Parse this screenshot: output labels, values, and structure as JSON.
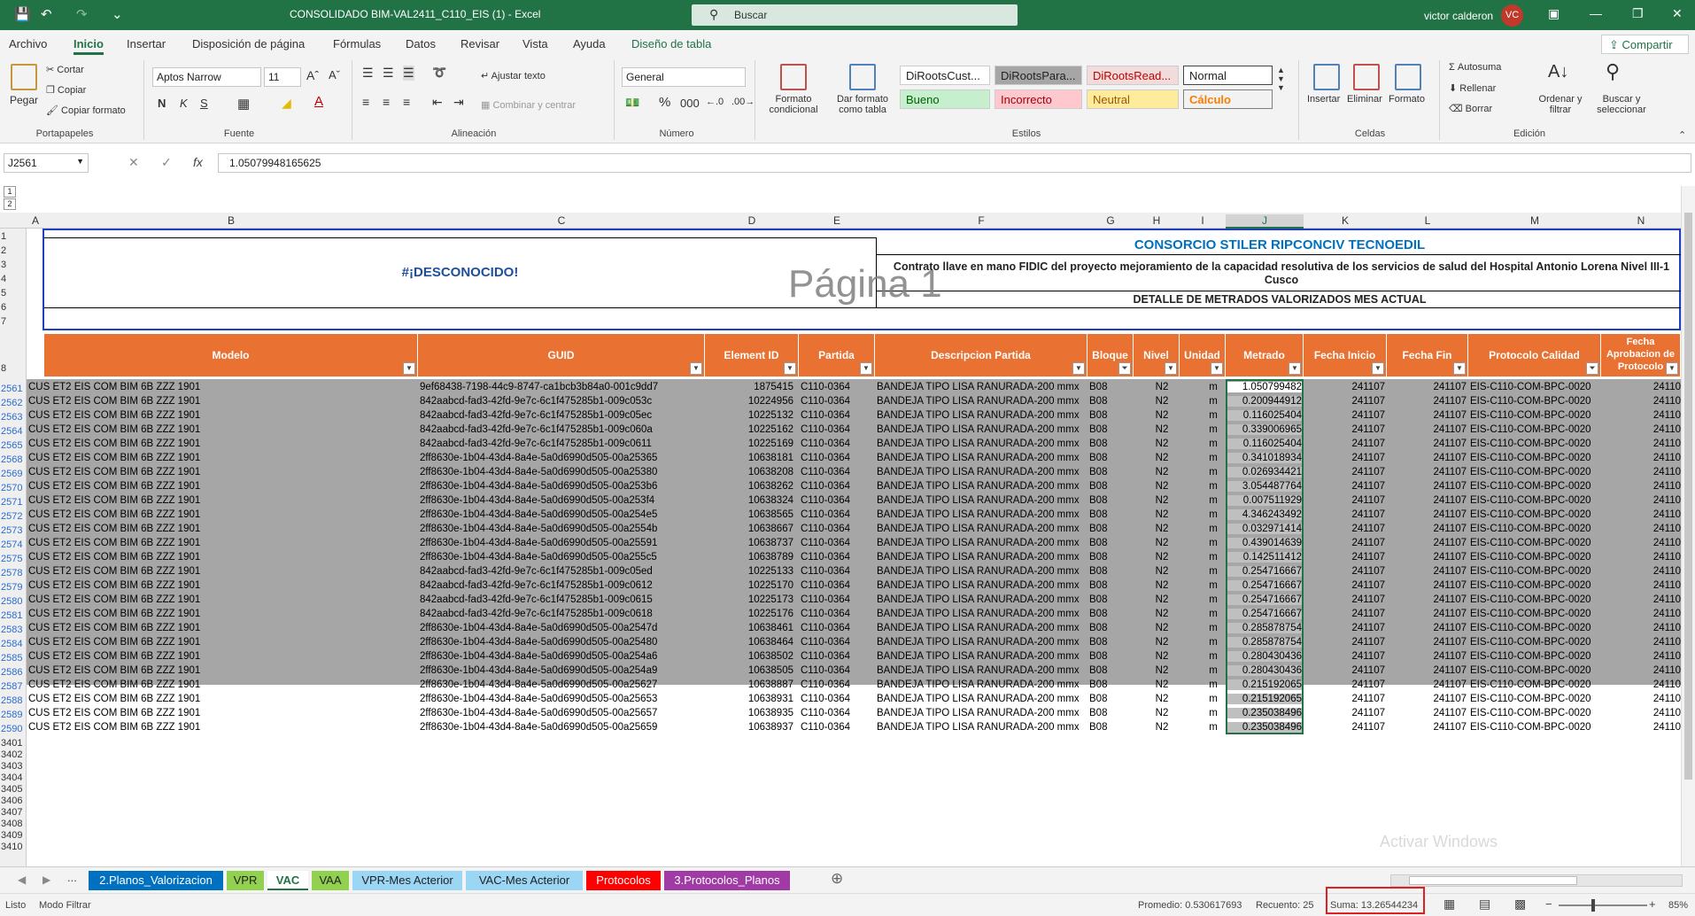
{
  "titlebar": {
    "title": "CONSOLIDADO BIM-VAL2411_C110_EIS (1)  -  Excel",
    "search_placeholder": "Buscar",
    "user": "victor calderon",
    "avatar": "VC"
  },
  "menu": {
    "items": [
      "Archivo",
      "Inicio",
      "Insertar",
      "Disposición de página",
      "Fórmulas",
      "Datos",
      "Revisar",
      "Vista",
      "Ayuda",
      "Diseño de tabla"
    ],
    "share": "Compartir"
  },
  "ribbon": {
    "pegar": "Pegar",
    "cortar": "Cortar",
    "copiar": "Copiar",
    "copiar_formato": "Copiar formato",
    "portapapeles": "Portapapeles",
    "font": "Aptos Narrow",
    "size": "11",
    "fuente": "Fuente",
    "bold": "N",
    "italic": "K",
    "underline": "S",
    "ajustar": "Ajustar texto",
    "combinar": "Combinar y centrar",
    "alineacion": "Alineación",
    "numfmt": "General",
    "numero": "Número",
    "pct": "%",
    "formato_cond": "Formato condicional",
    "dar_formato": "Dar formato como tabla",
    "styles": [
      "DiRootsCust...",
      "DiRootsPara...",
      "DiRootsRead...",
      "Normal",
      "Bueno",
      "Incorrecto",
      "Neutral",
      "Cálculo"
    ],
    "estilos": "Estilos",
    "insertar": "Insertar",
    "eliminar": "Eliminar",
    "formato": "Formato",
    "celdas": "Celdas",
    "autosuma": "Autosuma",
    "rellenar": "Rellenar",
    "borrar": "Borrar",
    "ordenar": "Ordenar y filtrar",
    "buscar": "Buscar y seleccionar",
    "edicion": "Edición"
  },
  "formula": {
    "namebox": "J2561",
    "value": "1.05079948165625"
  },
  "columns": [
    "A",
    "B",
    "C",
    "D",
    "E",
    "F",
    "G",
    "H",
    "I",
    "J",
    "K",
    "L",
    "M",
    "N"
  ],
  "sheet_header": {
    "unknown": "#¡DESCONOCIDO!",
    "consorcio": "CONSORCIO STILER RIPCONCIV TECNOEDIL",
    "contrato": "Contrato llave en mano FIDIC del proyecto mejoramiento de la capacidad resolutiva de los servicios de salud del Hospital Antonio Lorena Nivel III-1 Cusco",
    "detalle": "DETALLE DE METRADOS VALORIZADOS MES ACTUAL",
    "pagina": "Página 1"
  },
  "table_headers": [
    "Modelo",
    "GUID",
    "Element ID",
    "Partida",
    "Descripcion Partida",
    "Bloque",
    "Nivel",
    "Unidad",
    "Metrado",
    "Fecha Inicio",
    "Fecha Fin",
    "Protocolo Calidad",
    "Fecha Aprobacion de Protocolo"
  ],
  "header_rows": [
    "1",
    "2",
    "3",
    "4",
    "5",
    "6",
    "7",
    "8"
  ],
  "rows": [
    {
      "n": "2561",
      "guid": "9ef68438-7198-44c9-8747-ca1bcb3b84a0-001c9dd7",
      "eid": "1875415",
      "met": "1.050799482"
    },
    {
      "n": "2562",
      "guid": "842aabcd-fad3-42fd-9e7c-6c1f475285b1-009c053c",
      "eid": "10224956",
      "met": "0.200944912"
    },
    {
      "n": "2563",
      "guid": "842aabcd-fad3-42fd-9e7c-6c1f475285b1-009c05ec",
      "eid": "10225132",
      "met": "0.116025404"
    },
    {
      "n": "2564",
      "guid": "842aabcd-fad3-42fd-9e7c-6c1f475285b1-009c060a",
      "eid": "10225162",
      "met": "0.339006965"
    },
    {
      "n": "2565",
      "guid": "842aabcd-fad3-42fd-9e7c-6c1f475285b1-009c0611",
      "eid": "10225169",
      "met": "0.116025404"
    },
    {
      "n": "2568",
      "guid": "2ff8630e-1b04-43d4-8a4e-5a0d6990d505-00a25365",
      "eid": "10638181",
      "met": "0.341018934"
    },
    {
      "n": "2569",
      "guid": "2ff8630e-1b04-43d4-8a4e-5a0d6990d505-00a25380",
      "eid": "10638208",
      "met": "0.026934421"
    },
    {
      "n": "2570",
      "guid": "2ff8630e-1b04-43d4-8a4e-5a0d6990d505-00a253b6",
      "eid": "10638262",
      "met": "3.054487764"
    },
    {
      "n": "2571",
      "guid": "2ff8630e-1b04-43d4-8a4e-5a0d6990d505-00a253f4",
      "eid": "10638324",
      "met": "0.007511929"
    },
    {
      "n": "2572",
      "guid": "2ff8630e-1b04-43d4-8a4e-5a0d6990d505-00a254e5",
      "eid": "10638565",
      "met": "4.346243492"
    },
    {
      "n": "2573",
      "guid": "2ff8630e-1b04-43d4-8a4e-5a0d6990d505-00a2554b",
      "eid": "10638667",
      "met": "0.032971414"
    },
    {
      "n": "2574",
      "guid": "2ff8630e-1b04-43d4-8a4e-5a0d6990d505-00a25591",
      "eid": "10638737",
      "met": "0.439014639"
    },
    {
      "n": "2575",
      "guid": "2ff8630e-1b04-43d4-8a4e-5a0d6990d505-00a255c5",
      "eid": "10638789",
      "met": "0.142511412"
    },
    {
      "n": "2578",
      "guid": "842aabcd-fad3-42fd-9e7c-6c1f475285b1-009c05ed",
      "eid": "10225133",
      "met": "0.254716667"
    },
    {
      "n": "2579",
      "guid": "842aabcd-fad3-42fd-9e7c-6c1f475285b1-009c0612",
      "eid": "10225170",
      "met": "0.254716667"
    },
    {
      "n": "2580",
      "guid": "842aabcd-fad3-42fd-9e7c-6c1f475285b1-009c0615",
      "eid": "10225173",
      "met": "0.254716667"
    },
    {
      "n": "2581",
      "guid": "842aabcd-fad3-42fd-9e7c-6c1f475285b1-009c0618",
      "eid": "10225176",
      "met": "0.254716667"
    },
    {
      "n": "2583",
      "guid": "2ff8630e-1b04-43d4-8a4e-5a0d6990d505-00a2547d",
      "eid": "10638461",
      "met": "0.285878754"
    },
    {
      "n": "2584",
      "guid": "2ff8630e-1b04-43d4-8a4e-5a0d6990d505-00a25480",
      "eid": "10638464",
      "met": "0.285878754"
    },
    {
      "n": "2585",
      "guid": "2ff8630e-1b04-43d4-8a4e-5a0d6990d505-00a254a6",
      "eid": "10638502",
      "met": "0.280430436"
    },
    {
      "n": "2586",
      "guid": "2ff8630e-1b04-43d4-8a4e-5a0d6990d505-00a254a9",
      "eid": "10638505",
      "met": "0.280430436"
    },
    {
      "n": "2587",
      "guid": "2ff8630e-1b04-43d4-8a4e-5a0d6990d505-00a25627",
      "eid": "10638887",
      "met": "0.215192065"
    },
    {
      "n": "2588",
      "guid": "2ff8630e-1b04-43d4-8a4e-5a0d6990d505-00a25653",
      "eid": "10638931",
      "met": "0.215192065"
    },
    {
      "n": "2589",
      "guid": "2ff8630e-1b04-43d4-8a4e-5a0d6990d505-00a25657",
      "eid": "10638935",
      "met": "0.235038496"
    },
    {
      "n": "2590",
      "guid": "2ff8630e-1b04-43d4-8a4e-5a0d6990d505-00a25659",
      "eid": "10638937",
      "met": "0.235038496"
    }
  ],
  "row_common": {
    "modelo": "CUS ET2 EIS COM BIM 6B ZZZ 1901",
    "partida": "C110-0364",
    "desc": "BANDEJA TIPO LISA RANURADA-200 mmx",
    "bloque": "B08",
    "nivel": "N2",
    "unidad": "m",
    "fi": "241107",
    "ff": "241107",
    "prot": "EIS-C110-COM-BPC-0020",
    "fap": "24110"
  },
  "empty_rows": [
    "3401",
    "3402",
    "3403",
    "3404",
    "3405",
    "3406",
    "3407",
    "3408",
    "3409",
    "3410"
  ],
  "tabs": [
    {
      "label": "...",
      "color": "#f3f3f3"
    },
    {
      "label": "2.Planos_Valorizacion",
      "color": "#0070c0"
    },
    {
      "label": "VPR",
      "color": "#92d050"
    },
    {
      "label": "VAC",
      "color": "#ffffff"
    },
    {
      "label": "VAA",
      "color": "#92d050"
    },
    {
      "label": "VPR-Mes Acterior",
      "color": "#9bd7f5"
    },
    {
      "label": "VAC-Mes Acterior",
      "color": "#9bd7f5"
    },
    {
      "label": "Protocolos",
      "color": "#ff0000"
    },
    {
      "label": "3.Protocolos_Planos",
      "color": "#a03aa5"
    }
  ],
  "status": {
    "ready": "Listo",
    "mode": "Modo Filtrar",
    "avg": "Promedio: 0.530617693",
    "count": "Recuento: 25",
    "sum": "Suma: 13.26544234",
    "zoom": "85%"
  },
  "watermark": "Activar Windows"
}
